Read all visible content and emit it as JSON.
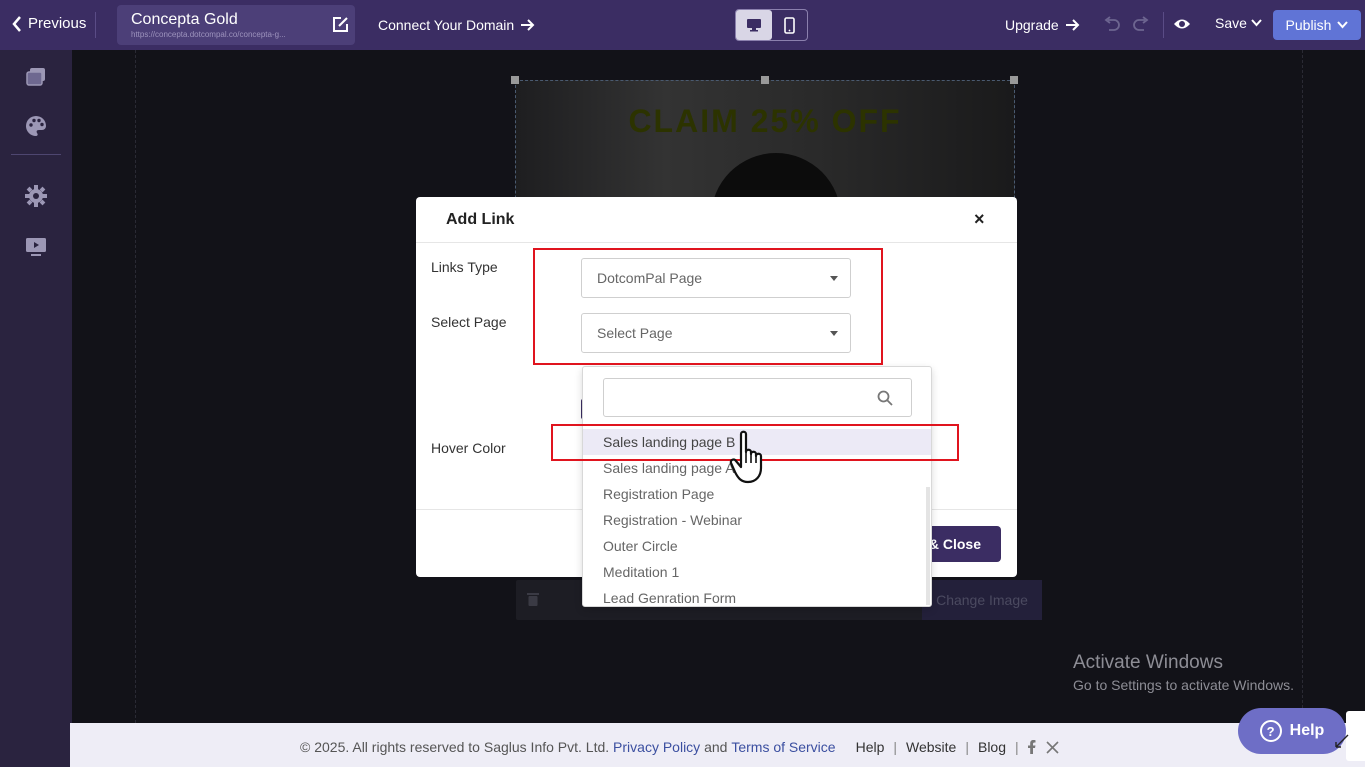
{
  "topbar": {
    "previous_label": "Previous",
    "site_name": "Concepta Gold",
    "site_url": "https://concepta.dotcompal.co/concepta-g...",
    "connect_label": "Connect Your Domain",
    "upgrade_label": "Upgrade",
    "save_label": "Save",
    "publish_label": "Publish"
  },
  "canvas": {
    "hero_text": "CLAIM 25% OFF",
    "change_image_label": "Change Image"
  },
  "modal": {
    "title": "Add Link",
    "close_glyph": "×",
    "links_type_label": "Links Type",
    "links_type_value": "DotcomPal Page",
    "select_page_label": "Select Page",
    "select_page_placeholder": "Select Page",
    "hover_color_label": "Hover Color",
    "save_close_label": "& Close"
  },
  "dropdown": {
    "search_value": "",
    "items": [
      "Sales landing page B",
      "Sales landing page A",
      "Registration Page",
      "Registration - Webinar",
      "Outer Circle",
      "Meditation 1",
      "Lead Genration Form"
    ]
  },
  "footer": {
    "copyright": "©  2025. All rights reserved to Saglus Info Pvt. Ltd.",
    "privacy_label": "Privacy Policy",
    "and_text": "and",
    "terms_label": "Terms of Service",
    "help_label": "Help",
    "website_label": "Website",
    "blog_label": "Blog"
  },
  "watermark": {
    "line1": "Activate Windows",
    "line2": "Go to Settings to activate Windows."
  },
  "help_widget": {
    "label": "Help"
  },
  "colors": {
    "topbar": "#3b2d63",
    "publish": "#6074d6",
    "highlight": "#e0141e",
    "link": "#3b4fa0"
  }
}
